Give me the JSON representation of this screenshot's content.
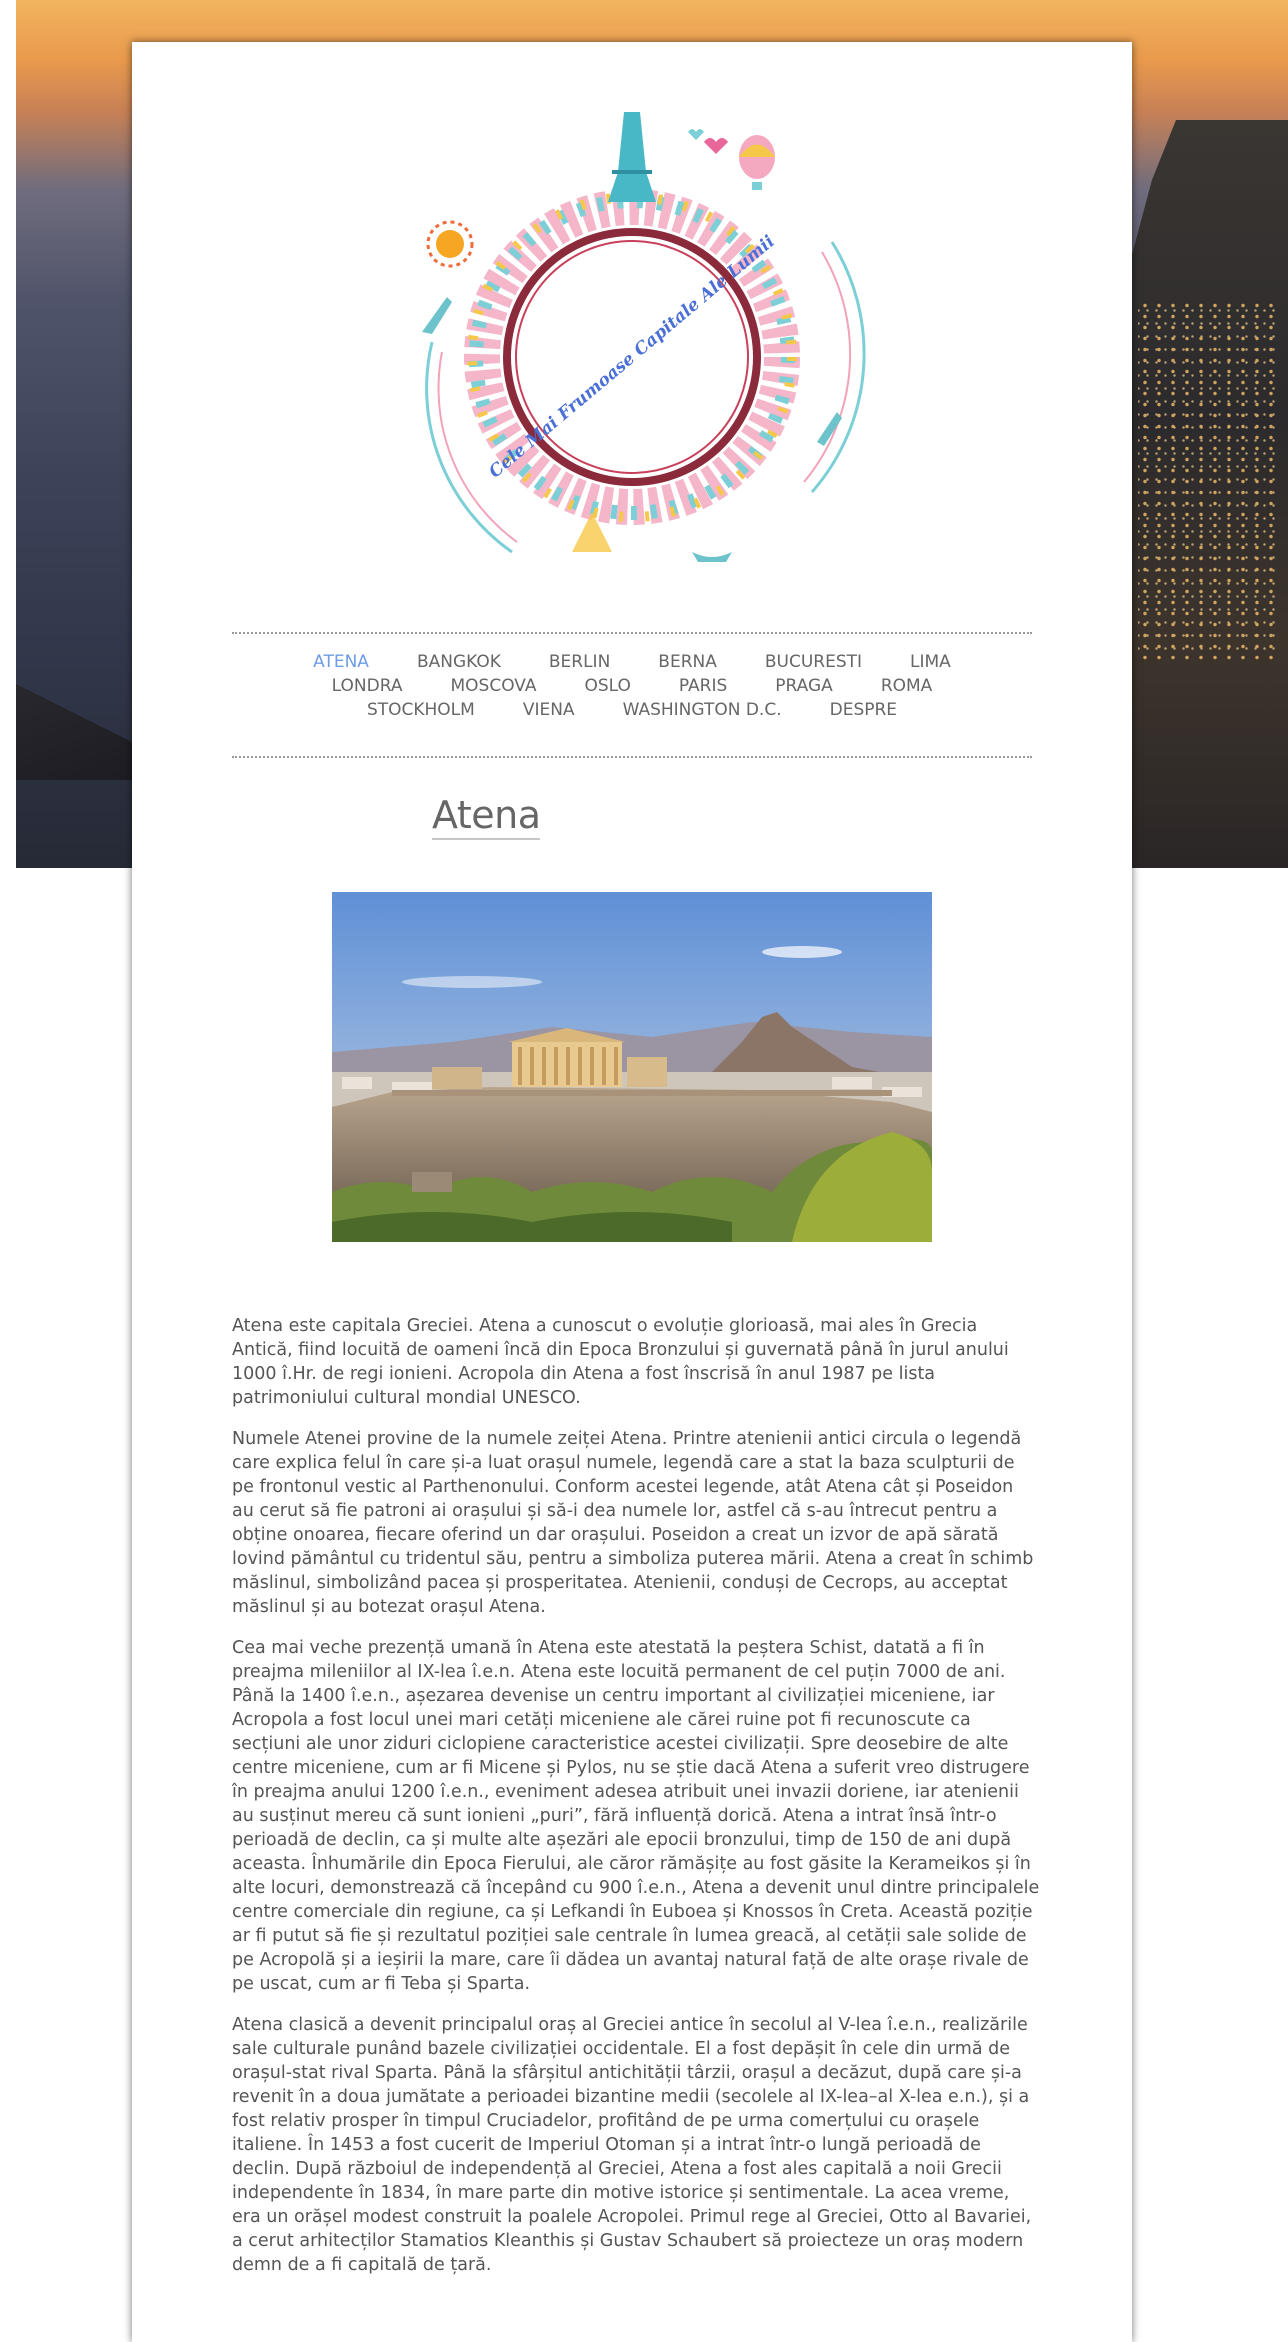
{
  "logo": {
    "ring_text": "Cele Mai Frumoase Capitale Ale Lumii"
  },
  "nav": {
    "row1": [
      "ATENA",
      "BANGKOK",
      "BERLIN",
      "BERNA",
      "BUCURESTI",
      "LIMA"
    ],
    "row2": [
      "LONDRA",
      "MOSCOVA",
      "OSLO",
      "PARIS",
      "PRAGA",
      "ROMA"
    ],
    "row3": [
      "STOCKHOLM",
      "VIENA",
      "WASHINGTON D.C.",
      "DESPRE"
    ],
    "active": "ATENA"
  },
  "page": {
    "title": "Atena"
  },
  "article": {
    "paragraphs": [
      "Atena este capitala Greciei. Atena a cunoscut o evoluție glorioasă, mai ales în Grecia Antică, fiind locuită de oameni încă din Epoca Bronzului și guvernată până în jurul anului 1000 î.Hr. de regi ionieni. Acropola din Atena a fost înscrisă în anul 1987 pe lista patrimoniului cultural mondial UNESCO.",
      "Numele Atenei provine de la numele zeiței Atena. Printre atenienii antici circula o legendă care explica felul în care și-a luat orașul numele, legendă care a stat la baza sculpturii de pe frontonul vestic al Parthenonului. Conform acestei legende, atât Atena cât și Poseidon au cerut să fie patroni ai orașului și să-i dea numele lor, astfel că s-au întrecut pentru a obține onoarea, fiecare oferind un dar orașului. Poseidon a creat un izvor de apă sărată lovind pământul cu tridentul său, pentru a simboliza puterea mării. Atena a creat în schimb măslinul, simbolizând pacea și prosperitatea. Atenienii, conduși de Cecrops, au acceptat măslinul și au botezat orașul Atena.",
      "Cea mai veche prezență umană în Atena este atestată la peștera Schist, datată a fi în preajma mileniilor al IX-lea î.e.n. Atena este locuită permanent de cel puțin 7000 de ani. Până la 1400 î.e.n., așezarea devenise un centru important al civilizației miceniene, iar Acropola a fost locul unei mari cetăți miceniene ale cărei ruine pot fi recunoscute ca secțiuni ale unor ziduri ciclopiene caracteristice acestei civilizații. Spre deosebire de alte centre miceniene, cum ar fi Micene și Pylos, nu se știe dacă Atena a suferit vreo distrugere în preajma anului 1200 î.e.n., eveniment adesea atribuit unei invazii doriene, iar atenienii au susținut mereu că sunt ionieni „puri”, fără influență dorică. Atena a intrat însă într-o perioadă de declin, ca și multe alte așezări ale epocii bronzului, timp de 150 de ani după aceasta. Înhumările din Epoca Fierului, ale căror rămășițe au fost găsite la Kerameikos și în alte locuri, demonstrează că începând cu 900 î.e.n., Atena a devenit unul dintre principalele centre comerciale din regiune, ca și Lefkandi în Euboea și Knossos în Creta. Această poziție ar fi putut să fie și rezultatul poziției sale centrale în lumea greacă, al cetății sale solide de pe Acropolă și a ieșirii la mare, care îi dădea un avantaj natural față de alte orașe rivale de pe uscat, cum ar fi Teba și Sparta.",
      "Atena clasică a devenit principalul oraș al Greciei antice în secolul al V-lea î.e.n., realizările sale culturale punând bazele civilizației occidentale. El a fost depășit în cele din urmă de orașul-stat rival Sparta. Până la sfârșitul antichității târzii, orașul a decăzut, după care și-a revenit în a doua jumătate a perioadei bizantine medii (secolele al IX-lea–al X-lea e.n.), și a fost relativ prosper în timpul Cruciadelor, profitând de pe urma comerțului cu orașele italiene. În 1453 a fost cucerit de Imperiul Otoman și a intrat într-o lungă perioadă de declin. După războiul de independență al Greciei, Atena a fost ales capitală a noii Grecii independente în 1834, în mare parte din motive istorice și sentimentale. La acea vreme, era un orășel modest construit la poalele Acropolei. Primul rege al Greciei, Otto al Bavariei, a cerut arhitecților Stamatios Kleanthis și Gustav Schaubert să proiecteze un oraș modern demn de a fi capitală de țară."
    ]
  },
  "colors": {
    "nav_text": "#666666",
    "nav_active": "#6e9ce6",
    "body_text": "#555555",
    "ring_text": "#4a6fd6",
    "ring": "#8a2a3a"
  }
}
